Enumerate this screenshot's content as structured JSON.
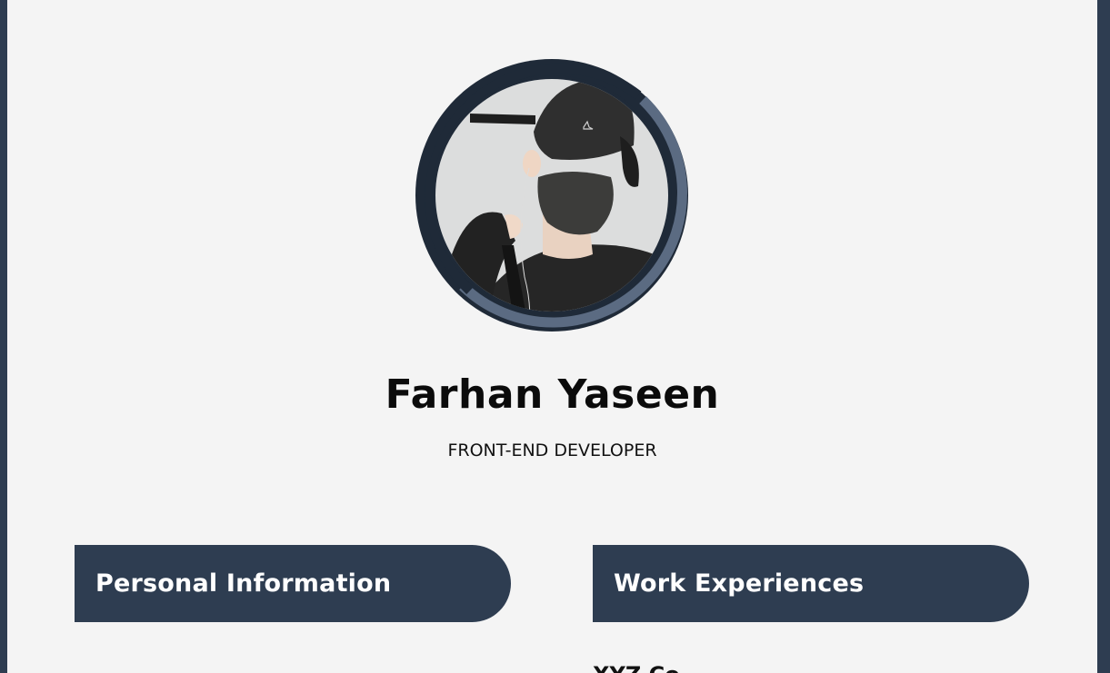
{
  "profile": {
    "name": "Farhan Yaseen",
    "role": "FRONT-END DEVELOPER"
  },
  "sections": {
    "personal_title": "Personal Information",
    "work_title": "Work Experiences",
    "work_first_entry": "XYZ Co."
  },
  "colors": {
    "accent": "#2e3d51",
    "ring_light": "#5b6b82",
    "page_bg": "#f4f4f4"
  }
}
